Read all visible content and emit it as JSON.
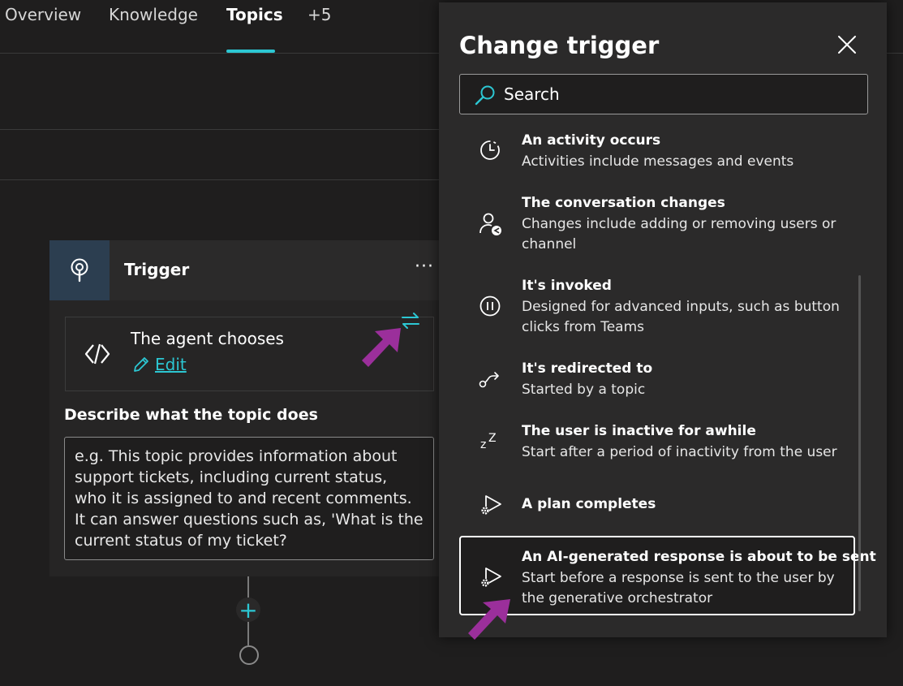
{
  "nav": {
    "tabs": [
      {
        "label": "Overview"
      },
      {
        "label": "Knowledge"
      },
      {
        "label": "Topics"
      },
      {
        "label": "+5"
      }
    ],
    "active_tab": "Topics"
  },
  "trigger_card": {
    "title": "Trigger",
    "more_label": "···",
    "agent_title": "The agent chooses",
    "edit_label": "Edit",
    "description_label": "Describe what the topic does",
    "description_placeholder": "e.g. This topic provides information about support tickets, including current status, who it is assigned to and recent comments. It can answer questions such as, 'What is the current status of my ticket?"
  },
  "panel": {
    "title": "Change trigger",
    "search_placeholder": "Search",
    "options": [
      {
        "title": "An activity occurs",
        "desc": "Activities include messages and events",
        "icon": "clock-icon"
      },
      {
        "title": "The conversation changes",
        "desc": "Changes include adding or removing users or channel",
        "icon": "person-change-icon"
      },
      {
        "title": "It's invoked",
        "desc": "Designed for advanced inputs, such as button clicks from Teams",
        "icon": "pause-circle-icon"
      },
      {
        "title": "It's redirected to",
        "desc": "Started by a topic",
        "icon": "redirect-icon"
      },
      {
        "title": "The user is inactive for awhile",
        "desc": "Start after a period of inactivity from the user",
        "icon": "sleep-icon"
      },
      {
        "title": "A plan completes",
        "desc": "",
        "icon": "play-gear-icon"
      },
      {
        "title": "An AI-generated response is about to be sent",
        "desc": "Start before a response is sent to the user by the generative orchestrator",
        "icon": "play-gear-icon"
      }
    ],
    "selected_option": "An AI-generated response is about to be sent"
  },
  "colors": {
    "accent": "#2cc7d3",
    "annotation_arrow": "#9b2f9b",
    "background": "#1f1e1e",
    "panel": "#2b2a2a"
  }
}
